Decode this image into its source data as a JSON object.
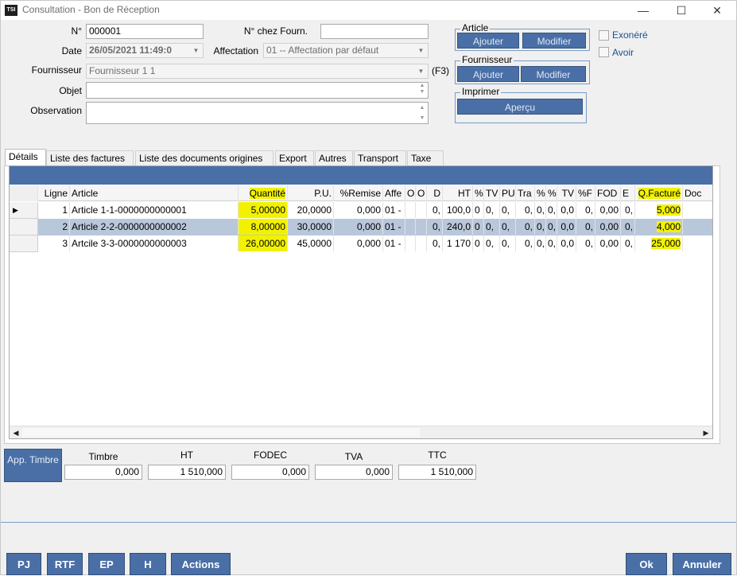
{
  "window": {
    "icon_text": "TSI",
    "title": "Consultation - Bon de Réception",
    "minimize": "—",
    "maximize": "☐",
    "close": "✕"
  },
  "form": {
    "no_label": "N°",
    "no_value": "000001",
    "supplier_no_label": "N° chez Fourn.",
    "supplier_no_value": "",
    "date_label": "Date",
    "date_value": "26/05/2021 11:49:0",
    "affectation_label": "Affectation",
    "affectation_value": "01 -- Affectation par défaut",
    "fournisseur_label": "Fournisseur",
    "fournisseur_value": "Fournisseur 1 1",
    "f3_hint": "(F3)",
    "objet_label": "Objet",
    "objet_value": "",
    "observation_label": "Observation",
    "observation_value": ""
  },
  "groups": {
    "article": {
      "title": "Article",
      "add": "Ajouter",
      "edit": "Modifier"
    },
    "fournisseur": {
      "title": "Fournisseur",
      "add": "Ajouter",
      "edit": "Modifier"
    },
    "imprimer": {
      "title": "Imprimer",
      "preview": "Aperçu"
    }
  },
  "options": {
    "exonere": {
      "label": "Exonéré",
      "checked": false
    },
    "avoir": {
      "label": "Avoir",
      "checked": false
    }
  },
  "tabs": [
    "Détails",
    "Liste des factures",
    "Liste des documents origines",
    "Export",
    "Autres",
    "Transport",
    "Taxe"
  ],
  "grid": {
    "headers": [
      "Ligne",
      "Article",
      "Quantité",
      "P.U.",
      "%Remise",
      "Affe",
      "O",
      "O",
      "D",
      "HT",
      "%",
      "TV",
      "PU",
      "Tra",
      "%",
      "%",
      "TV",
      "%F",
      "FOD",
      "E",
      "Q.Facturé",
      "Doc"
    ],
    "rows": [
      {
        "ligne": "1",
        "article": "Article 1-1-0000000000001",
        "quantite": "5,00000",
        "pu": "20,0000",
        "remise": "0,000",
        "affe": "01 -",
        "d": "0,",
        "ht": "100,0",
        "c1": "0",
        "c2": "0,",
        "c3": "0,",
        "c4": "0,",
        "c5": "0,",
        "c6": "0,",
        "c7": "0,0",
        "c8": "0,",
        "fod": "0,00",
        "e": "0,",
        "qfacture": "5,000",
        "doc": "",
        "selected": false,
        "current": true
      },
      {
        "ligne": "2",
        "article": "Article 2-2-0000000000002",
        "quantite": "8,00000",
        "pu": "30,0000",
        "remise": "0,000",
        "affe": "01 -",
        "d": "0,",
        "ht": "240,0",
        "c1": "0",
        "c2": "0,",
        "c3": "0,",
        "c4": "0,",
        "c5": "0,",
        "c6": "0,",
        "c7": "0,0",
        "c8": "0,",
        "fod": "0,00",
        "e": "0,",
        "qfacture": "4,000",
        "doc": "",
        "selected": true,
        "current": false
      },
      {
        "ligne": "3",
        "article": "Artcile 3-3-0000000000003",
        "quantite": "26,00000",
        "pu": "45,0000",
        "remise": "0,000",
        "affe": "01 -",
        "d": "0,",
        "ht": "1 170",
        "c1": "0",
        "c2": "0,",
        "c3": "0,",
        "c4": "0,",
        "c5": "0,",
        "c6": "0,",
        "c7": "0,0",
        "c8": "0,",
        "fod": "0,00",
        "e": "0,",
        "qfacture": "25,000",
        "doc": "",
        "selected": false,
        "current": false
      }
    ]
  },
  "totals": {
    "app_timbre": "App. Timbre",
    "timbre_label": "Timbre",
    "timbre_value": "0,000",
    "ht_label": "HT",
    "ht_value": "1 510,000",
    "fodec_label": "FODEC",
    "fodec_value": "0,000",
    "tva_label": "TVA",
    "tva_value": "0,000",
    "ttc_label": "TTC",
    "ttc_value": "1 510,000"
  },
  "footer": {
    "pj": "PJ",
    "rtf": "RTF",
    "ep": "EP",
    "h": "H",
    "actions": "Actions",
    "ok": "Ok",
    "annuler": "Annuler"
  },
  "colors": {
    "accent": "#4a6fa6",
    "highlight": "#f2f200",
    "selected_row": "#b9c7db"
  }
}
